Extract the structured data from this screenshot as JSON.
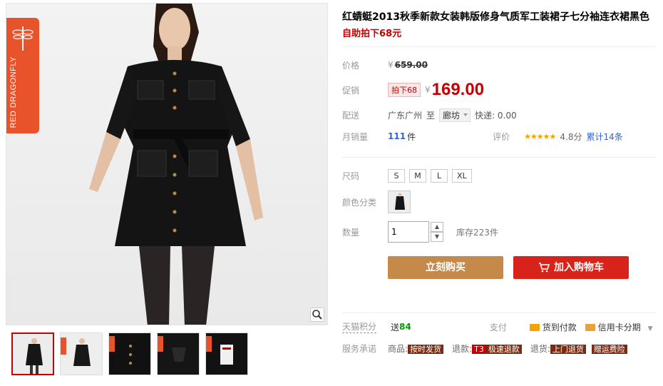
{
  "product": {
    "title": "红蜻蜓2013秋季新款女装韩版修身气质军工装裙子七分袖连衣裙黑色",
    "promo_subtitle": "自助拍下68元"
  },
  "brand": {
    "name_en": "RED DRAGONFLY",
    "name_cn": "红蜻蜓"
  },
  "price": {
    "label": "价格",
    "currency": "¥",
    "original": "659.00"
  },
  "promo": {
    "label": "促销",
    "badge": "拍下68",
    "currency": "¥",
    "price": "169.00"
  },
  "shipping": {
    "label": "配送",
    "from": "广东广州",
    "to_word": "至",
    "destination": "廊坊",
    "express": "快递: 0.00"
  },
  "sales": {
    "label": "月销量",
    "count": "111",
    "unit": "件",
    "rating_label": "评价",
    "stars": "★★★★★",
    "score": "4.8分",
    "reviews": "累计14条"
  },
  "size": {
    "label": "尺码",
    "options": [
      "S",
      "M",
      "L",
      "XL"
    ]
  },
  "color": {
    "label": "颜色分类"
  },
  "quantity": {
    "label": "数量",
    "value": "1",
    "up": "▲",
    "down": "▼",
    "stock": "库存223件"
  },
  "actions": {
    "buy_now": "立刻购买",
    "add_to_cart": "加入购物车"
  },
  "points": {
    "label": "天猫积分",
    "prefix": "送",
    "value": "84",
    "pay_label": "支付",
    "cod": "货到付款",
    "credit": "信用卡分期"
  },
  "service": {
    "label": "服务承诺",
    "goods_label": "商品:",
    "goods_chip": "按时发货",
    "refund_label": "退款:",
    "refund_t3": "T3",
    "refund_chip": "极速退款",
    "return_label": "退货:",
    "return_chip": "上门退货",
    "freight_chip": "赠运费险"
  },
  "colors": {
    "promo_red": "#c40000",
    "buy_button": "#c58a4a",
    "cart_button": "#d8231b",
    "brand_orange": "#e8532b"
  }
}
